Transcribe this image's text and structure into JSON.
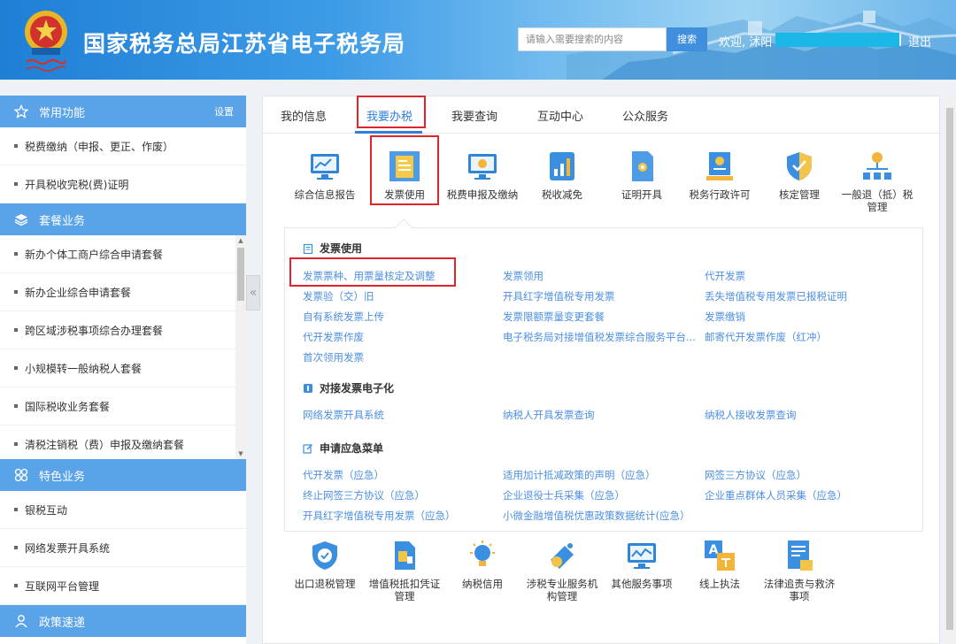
{
  "header": {
    "site_title": "国家税务总局江苏省电子税务局",
    "search_placeholder": "请输入需要搜索的内容",
    "search_button": "搜索",
    "welcome": "欢迎, 沭阳",
    "logout": "退出"
  },
  "sidebar": {
    "sections": [
      {
        "title": "常用功能",
        "action": "设置",
        "items": [
          "税费缴纳（申报、更正、作废）",
          "开具税收完税(费)证明"
        ]
      },
      {
        "title": "套餐业务",
        "items": [
          "新办个体工商户综合申请套餐",
          "新办企业综合申请套餐",
          "跨区域涉税事项综合办理套餐",
          "小规模转一般纳税人套餐",
          "国际税收业务套餐",
          "清税注销税（费）申报及缴纳套餐"
        ]
      },
      {
        "title": "特色业务",
        "items": [
          "银税互动",
          "网络发票开具系统",
          "互联网平台管理"
        ]
      },
      {
        "title": "政策速递"
      }
    ]
  },
  "tabs": [
    "我的信息",
    "我要办税",
    "我要查询",
    "互动中心",
    "公众服务"
  ],
  "top_icons": [
    {
      "label": "综合信息报告",
      "icon": "monitor-chart-icon"
    },
    {
      "label": "发票使用",
      "icon": "invoice-icon"
    },
    {
      "label": "税费申报及缴纳",
      "icon": "monitor-coin-icon"
    },
    {
      "label": "税收减免",
      "icon": "tax-reduction-icon"
    },
    {
      "label": "证明开具",
      "icon": "certificate-icon"
    },
    {
      "label": "税务行政许可",
      "icon": "license-icon"
    },
    {
      "label": "核定管理",
      "icon": "shield-icon"
    },
    {
      "label": "一般退（抵）税管理",
      "icon": "network-icon"
    }
  ],
  "groups": [
    {
      "title": "发票使用",
      "links": [
        "发票票种、用票量核定及调整",
        "发票领用",
        "代开发票",
        "发票验（交）旧",
        "开具红字增值税专用发票",
        "丢失增值税专用发票已报税证明",
        "自有系统发票上传",
        "发票限额票量变更套餐",
        "发票缴销",
        "代开发票作废",
        "电子税务局对接增值税发票综合服务平台...",
        "邮寄代开发票作废（红冲）",
        "首次领用发票"
      ]
    },
    {
      "title": "对接发票电子化",
      "links": [
        "网络发票开具系统",
        "纳税人开具发票查询",
        "纳税人接收发票查询"
      ]
    },
    {
      "title": "申请应急菜单",
      "links": [
        "代开发票（应急）",
        "适用加计抵减政策的声明（应急）",
        "网签三方协议（应急）",
        "终止网签三方协议（应急）",
        "企业退役士兵采集（应急）",
        "企业重点群体人员采集（应急）",
        "开具红字增值税专用发票（应急）",
        "小微金融增值税优惠政策数据统计(应急）"
      ]
    }
  ],
  "bottom_icons": [
    {
      "label": "出口退税管理",
      "icon": "export-shield-icon"
    },
    {
      "label": "增值税抵扣凭证管理",
      "icon": "voucher-icon"
    },
    {
      "label": "纳税信用",
      "icon": "credit-bulb-icon"
    },
    {
      "label": "涉税专业服务机构管理",
      "icon": "agency-icon"
    },
    {
      "label": "其他服务事项",
      "icon": "monitor-wave-icon"
    },
    {
      "label": "线上执法",
      "icon": "translate-icon"
    },
    {
      "label": "法律追责与救济事项",
      "icon": "legal-doc-icon"
    }
  ],
  "colors": {
    "accent": "#2f7fd9",
    "sidebar_header": "#5aa3e8",
    "highlight": "#e0242b",
    "link": "#4d8fe0"
  }
}
